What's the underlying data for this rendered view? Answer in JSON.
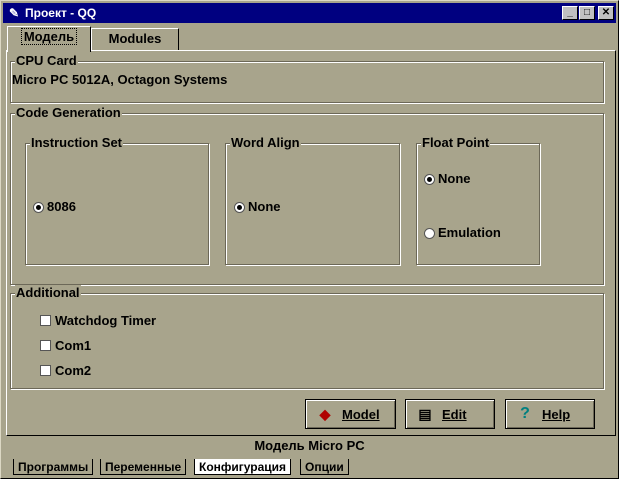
{
  "window": {
    "title": "Проект - QQ",
    "app_icon": "app-icon",
    "controls": [
      "minimize-icon",
      "maximize-icon",
      "close-icon"
    ]
  },
  "tabs": [
    {
      "label": "Модель",
      "active": true
    },
    {
      "label": "Modules",
      "active": false
    }
  ],
  "cpu_card": {
    "title": "CPU Card",
    "value": "Micro PC 5012A, Octagon Systems"
  },
  "code_generation": {
    "title": "Code Generation",
    "instruction_set": {
      "title": "Instruction Set",
      "options": [
        {
          "label": "8086",
          "checked": true
        }
      ]
    },
    "word_align": {
      "title": "Word Align",
      "options": [
        {
          "label": "None",
          "checked": true
        }
      ]
    },
    "float_point": {
      "title": "Float Point",
      "options": [
        {
          "label": "None",
          "checked": true
        },
        {
          "label": "Emulation",
          "checked": false
        }
      ]
    }
  },
  "additional": {
    "title": "Additional",
    "items": [
      {
        "label": "Watchdog Timer",
        "checked": false
      },
      {
        "label": "Com1",
        "checked": false
      },
      {
        "label": "Com2",
        "checked": false
      }
    ]
  },
  "buttons": {
    "model": {
      "label": "Model",
      "icon": "eraser-icon"
    },
    "edit": {
      "label": "Edit",
      "icon": "document-edit-icon"
    },
    "help": {
      "label": "Help",
      "icon": "question-mark-icon"
    }
  },
  "status": "Модель Micro PC",
  "bottom_tabs": [
    {
      "label": "Программы",
      "selected": false
    },
    {
      "label": "Переменные",
      "selected": false
    },
    {
      "label": "Конфигурация",
      "selected": true
    },
    {
      "label": "Опции",
      "selected": false
    }
  ]
}
